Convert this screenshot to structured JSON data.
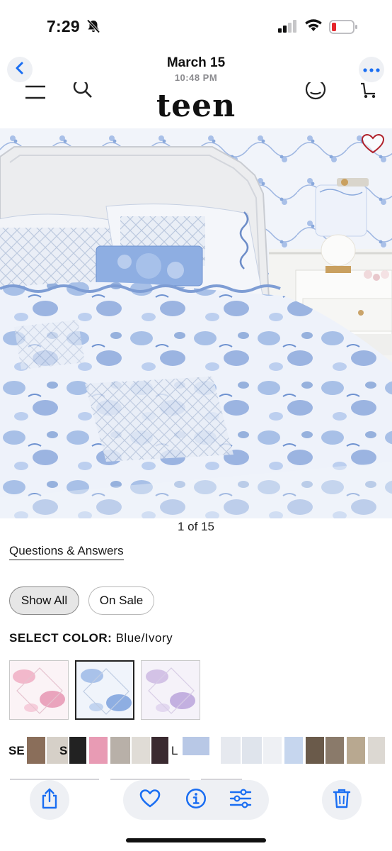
{
  "status_bar": {
    "time": "7:29",
    "icons": [
      "bell-slash-icon",
      "cellular-signal-icon",
      "wifi-icon",
      "battery-low-icon"
    ]
  },
  "photo_header": {
    "date": "March 15",
    "time": "10:48 PM",
    "back_icon": "chevron-left-icon",
    "more_icon": "ellipsis-icon"
  },
  "site_header": {
    "brand": "teen",
    "icons": [
      "menu-icon",
      "search-icon",
      "account-icon",
      "cart-icon"
    ]
  },
  "product": {
    "image_counter": "1 of 15",
    "favorite_icon": "heart-outline-icon",
    "qa_link": "Questions & Answers",
    "filters": [
      "Show All",
      "On Sale"
    ],
    "active_filter": "Show All",
    "select_color_label": "SELECT COLOR:",
    "select_color_value": "Blue/Ivory",
    "swatches": [
      {
        "name": "pink-floral",
        "color": "#f2c6d3"
      },
      {
        "name": "blue-floral",
        "color": "#b9cdea",
        "selected": true
      },
      {
        "name": "lavender-floral",
        "color": "#d6c9e6"
      }
    ]
  },
  "strip_text": {
    "se": "SE",
    "s": "S",
    "l": "L"
  },
  "toolbar": {
    "icons": [
      "share-icon",
      "heart-icon",
      "info-icon",
      "adjust-icon",
      "trash-icon"
    ]
  },
  "colors": {
    "ios_blue": "#1a6ef2",
    "brand_red": "#b0202a",
    "bed_blue": "#5b85c9",
    "wall_blue": "#8aa9dc"
  }
}
